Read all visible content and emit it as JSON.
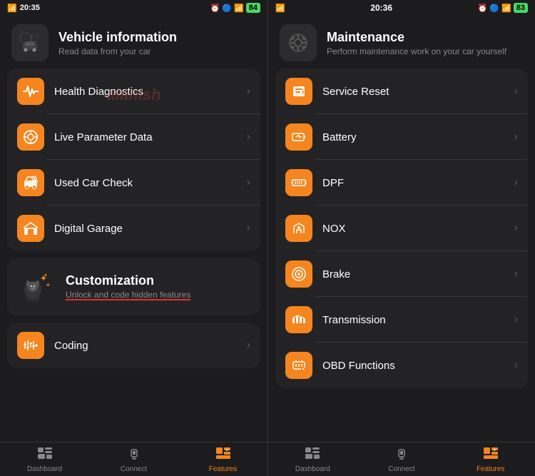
{
  "left": {
    "statusBar": {
      "left": "20:35",
      "batteryLevel": "84",
      "icons": [
        "signal",
        "wifi",
        "bluetooth"
      ]
    },
    "header": {
      "title": "Vehicle information",
      "subtitle": "Read data from your car"
    },
    "watermark": "alanish",
    "menuItems": [
      {
        "id": "health",
        "label": "Health Diagnostics",
        "icon": "pulse"
      },
      {
        "id": "live",
        "label": "Live Parameter Data",
        "icon": "gauge"
      },
      {
        "id": "used-car",
        "label": "Used Car Check",
        "icon": "car-check"
      },
      {
        "id": "garage",
        "label": "Digital Garage",
        "icon": "garage"
      }
    ],
    "customization": {
      "title": "Customization",
      "subtitle": "Unlock and code hidden features"
    },
    "codingItems": [
      {
        "id": "coding",
        "label": "Coding",
        "icon": "sliders"
      }
    ],
    "nav": [
      {
        "id": "dashboard",
        "label": "Dashboard",
        "icon": "dashboard",
        "active": false
      },
      {
        "id": "connect",
        "label": "Connect",
        "icon": "connect",
        "active": false
      },
      {
        "id": "features",
        "label": "Features",
        "icon": "features",
        "active": true
      }
    ]
  },
  "right": {
    "statusBar": {
      "left": "20:36",
      "batteryLevel": "83"
    },
    "header": {
      "title": "Maintenance",
      "subtitle": "Perform maintenance work on your car yourself"
    },
    "menuItems": [
      {
        "id": "service",
        "label": "Service Reset",
        "icon": "service"
      },
      {
        "id": "battery",
        "label": "Battery",
        "icon": "battery"
      },
      {
        "id": "dpf",
        "label": "DPF",
        "icon": "dpf"
      },
      {
        "id": "nox",
        "label": "NOX",
        "icon": "nox"
      },
      {
        "id": "brake",
        "label": "Brake",
        "icon": "brake"
      },
      {
        "id": "transmission",
        "label": "Transmission",
        "icon": "transmission"
      },
      {
        "id": "obd",
        "label": "OBD Functions",
        "icon": "obd"
      }
    ],
    "nav": [
      {
        "id": "dashboard",
        "label": "Dashboard",
        "icon": "dashboard",
        "active": false
      },
      {
        "id": "connect",
        "label": "Connect",
        "icon": "connect",
        "active": false
      },
      {
        "id": "features",
        "label": "Features",
        "icon": "features",
        "active": true
      }
    ]
  }
}
